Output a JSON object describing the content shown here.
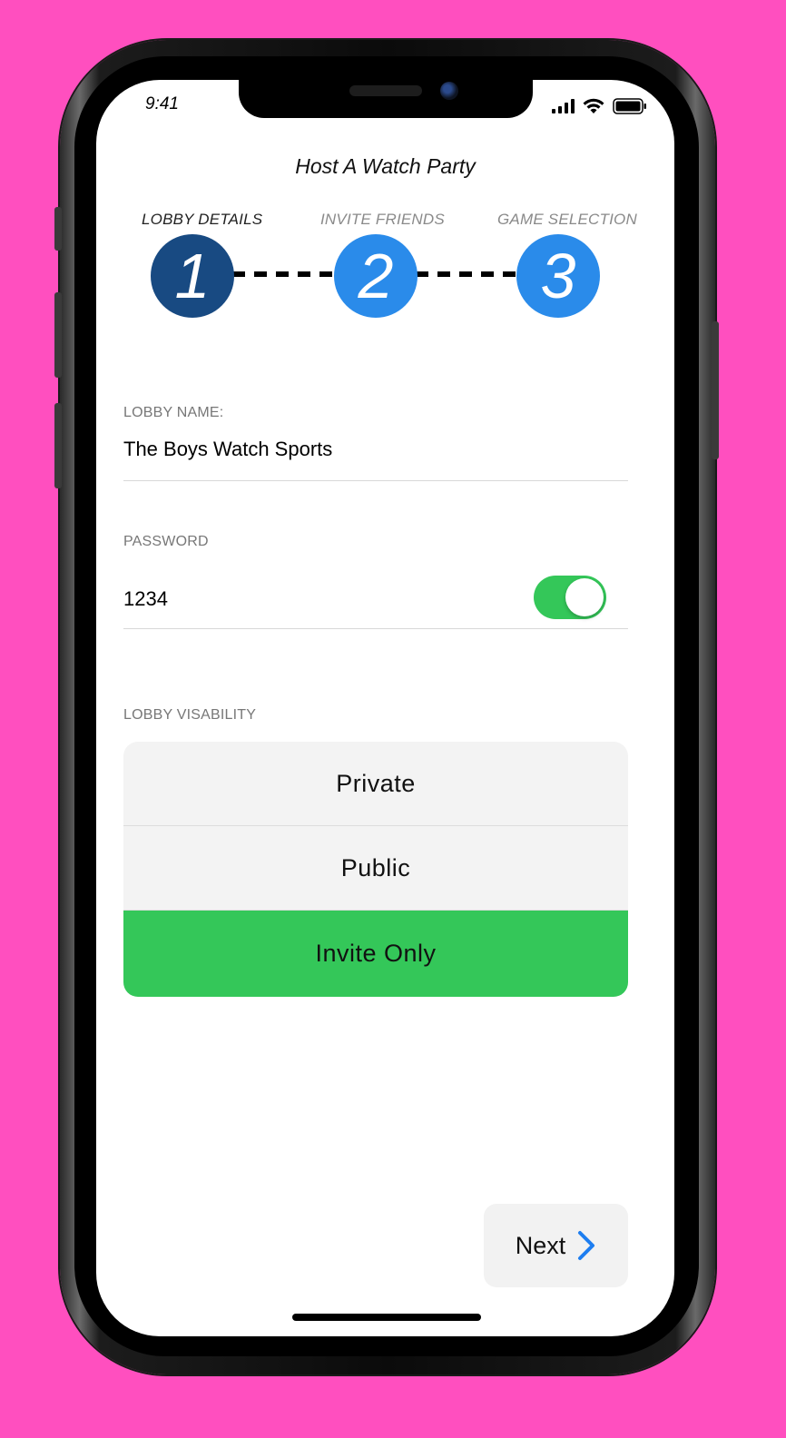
{
  "status_bar": {
    "time": "9:41",
    "signal_icon": "cellular-signal-icon",
    "wifi_icon": "wifi-icon",
    "battery_icon": "battery-icon"
  },
  "header": {
    "title": "Host A Watch Party"
  },
  "steps": [
    {
      "label": "LOBBY DETAILS",
      "number": "1",
      "active": true,
      "color": "#184a82"
    },
    {
      "label": "INVITE FRIENDS",
      "number": "2",
      "active": false,
      "color": "#2a8bea"
    },
    {
      "label": "GAME SELECTION",
      "number": "3",
      "active": false,
      "color": "#2a8bea"
    }
  ],
  "form": {
    "lobby_name": {
      "label": "LOBBY NAME:",
      "value": "The Boys Watch Sports"
    },
    "password": {
      "label": "PASSWORD",
      "value": "1234",
      "toggle_on": true
    },
    "visibility": {
      "label": "LOBBY VISABILITY",
      "options": [
        "Private",
        "Public",
        "Invite Only"
      ],
      "selected": "Invite Only"
    }
  },
  "footer": {
    "next_label": "Next",
    "next_icon": "chevron-right-icon"
  },
  "colors": {
    "background": "#ff4fbf",
    "accent_green": "#34c759",
    "step_active": "#184a82",
    "step_inactive": "#2a8bea",
    "chevron": "#1e7ef0"
  }
}
